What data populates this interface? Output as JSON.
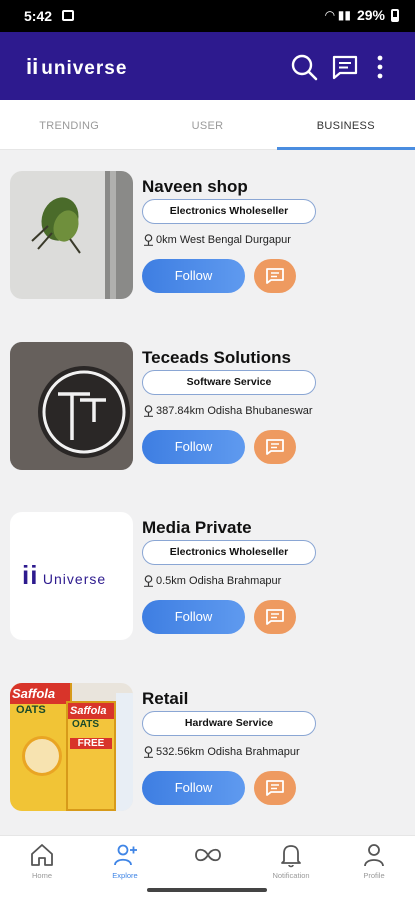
{
  "status_bar": {
    "time": "5:42",
    "battery": "29%"
  },
  "app": {
    "logo_mark": "ii",
    "logo_text": "universe"
  },
  "tabs": [
    {
      "label": "TRENDING",
      "active": false
    },
    {
      "label": "USER",
      "active": false
    },
    {
      "label": "BUSINESS",
      "active": true
    }
  ],
  "businesses": [
    {
      "name": "Naveen shop",
      "category": "Electronics Wholeseller",
      "location": "0km West Bengal Durgapur",
      "follow_label": "Follow",
      "thumb": "insect-photo"
    },
    {
      "name": "Teceads Solutions",
      "category": "Software  Service",
      "location": "387.84km Odisha Bhubaneswar",
      "follow_label": "Follow",
      "thumb": "tc-logo-sign"
    },
    {
      "name": "Media Private",
      "category": "Electronics Wholeseller",
      "location": "0.5km Odisha Brahmapur",
      "follow_label": "Follow",
      "thumb": "ii-universe-logo",
      "thumb_mark": "ii",
      "thumb_text": "Universe"
    },
    {
      "name": "Retail",
      "category": "Hardware Service",
      "location": "532.56km Odisha Brahmapur",
      "follow_label": "Follow",
      "thumb": "saffola-oats-packs",
      "thumb_brand": "Saffola",
      "thumb_product": "OATS",
      "thumb_badge": "FREE"
    }
  ],
  "bottom_nav": [
    {
      "label": "Home",
      "icon": "home-icon",
      "active": false
    },
    {
      "label": "Explore",
      "icon": "add-user-icon",
      "active": true
    },
    {
      "label": "",
      "icon": "infinity-icon",
      "active": false
    },
    {
      "label": "Notification",
      "icon": "bell-icon",
      "active": false
    },
    {
      "label": "Profile",
      "icon": "person-icon",
      "active": false
    }
  ],
  "colors": {
    "app_bar": "#2d1a8e",
    "accent": "#4a8de0",
    "message_button": "#ee9a60",
    "status_bar": "#000000"
  }
}
